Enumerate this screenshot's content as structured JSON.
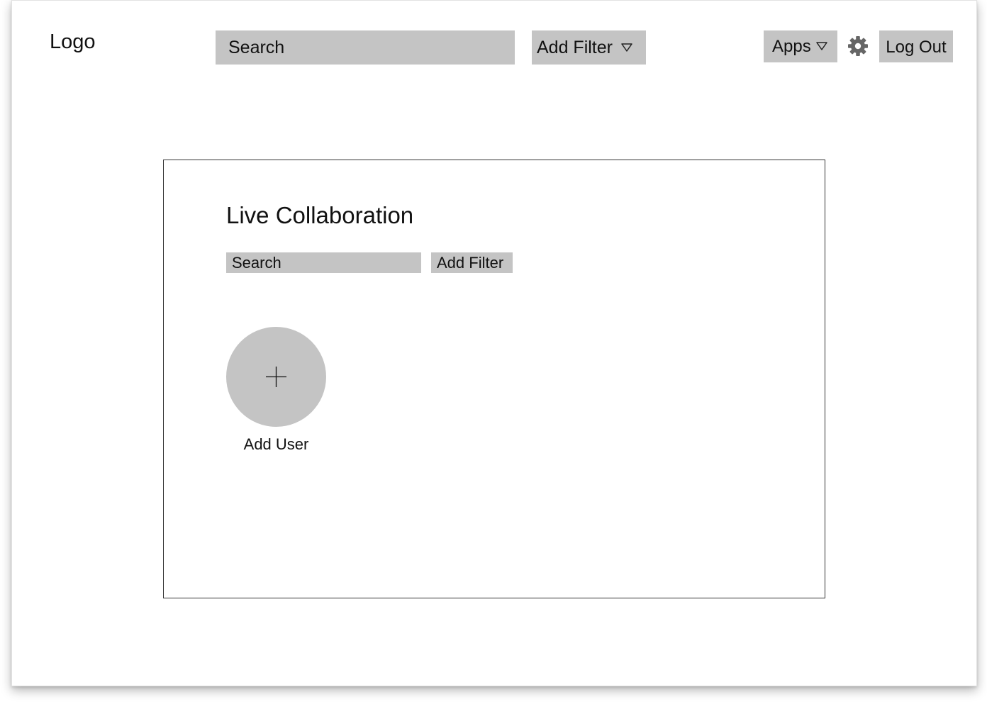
{
  "header": {
    "logo_text": "Logo",
    "search_label": "Search",
    "filter_label": "Add Filter",
    "apps_label": "Apps",
    "settings_icon": "gear-icon",
    "logout_label": "Log Out"
  },
  "panel": {
    "title": "Live Collaboration",
    "search_label": "Search",
    "filter_label": "Add Filter",
    "add_user_label": "Add User",
    "add_user_icon": "plus-icon"
  },
  "colors": {
    "control_fill": "#c4c4c4",
    "panel_border": "#333333",
    "text": "#111111"
  }
}
